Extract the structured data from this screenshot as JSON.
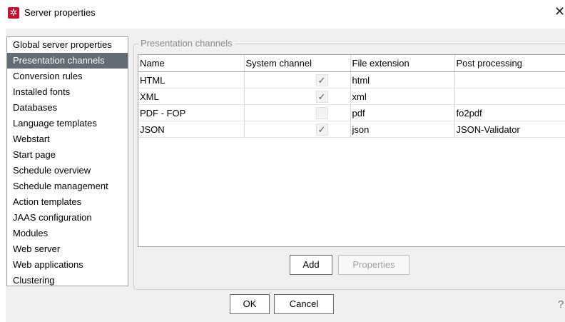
{
  "window": {
    "title": "Server properties",
    "close_glyph": "✕",
    "help_glyph": "?"
  },
  "sidebar": {
    "items": [
      {
        "label": "Global server properties",
        "selected": false
      },
      {
        "label": "Presentation channels",
        "selected": true
      },
      {
        "label": "Conversion rules",
        "selected": false
      },
      {
        "label": "Installed fonts",
        "selected": false
      },
      {
        "label": "Databases",
        "selected": false
      },
      {
        "label": "Language templates",
        "selected": false
      },
      {
        "label": "Webstart",
        "selected": false
      },
      {
        "label": "Start page",
        "selected": false
      },
      {
        "label": "Schedule overview",
        "selected": false
      },
      {
        "label": "Schedule management",
        "selected": false
      },
      {
        "label": "Action templates",
        "selected": false
      },
      {
        "label": "JAAS configuration",
        "selected": false
      },
      {
        "label": "Modules",
        "selected": false
      },
      {
        "label": "Web server",
        "selected": false
      },
      {
        "label": "Web applications",
        "selected": false
      },
      {
        "label": "Clustering",
        "selected": false
      }
    ]
  },
  "panel": {
    "group_label": "Presentation channels",
    "columns": [
      "Name",
      "System channel",
      "File extension",
      "Post processing"
    ],
    "rows": [
      {
        "name": "HTML",
        "system_channel": true,
        "extension": "html",
        "post": ""
      },
      {
        "name": "XML",
        "system_channel": true,
        "extension": "xml",
        "post": ""
      },
      {
        "name": "PDF - FOP",
        "system_channel": false,
        "extension": "pdf",
        "post": "fo2pdf"
      },
      {
        "name": "JSON",
        "system_channel": true,
        "extension": "json",
        "post": "JSON-Validator"
      }
    ],
    "add_label": "Add",
    "properties_label": "Properties"
  },
  "footer": {
    "ok_label": "OK",
    "cancel_label": "Cancel"
  },
  "icons": {
    "app": "gear-icon",
    "check": "checkmark-icon"
  },
  "colors": {
    "selection": "#636b74",
    "app_icon": "#c8102e"
  }
}
